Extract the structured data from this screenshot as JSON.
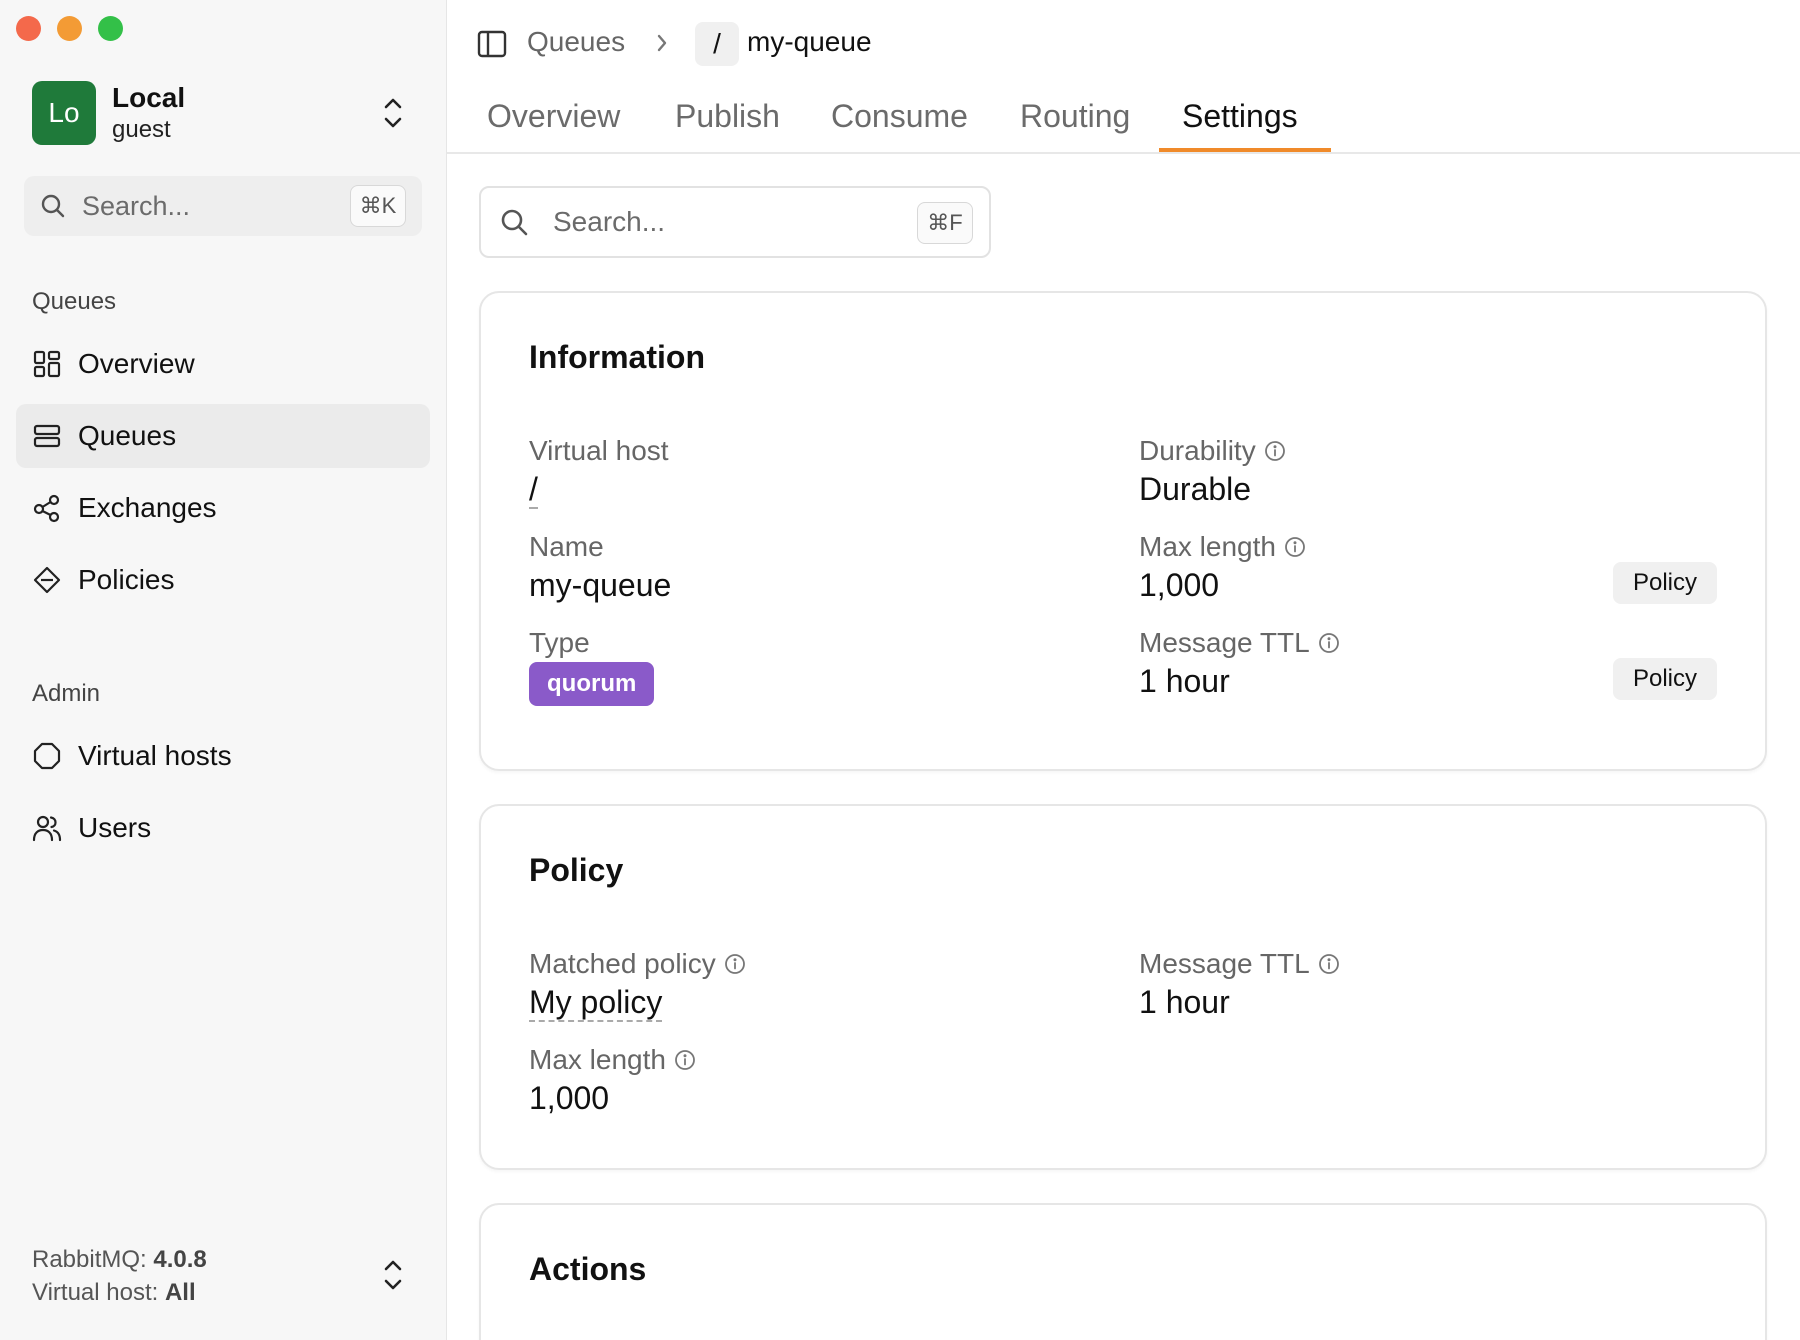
{
  "sidebar": {
    "account": {
      "initials": "Lo",
      "name": "Local",
      "user": "guest"
    },
    "search": {
      "placeholder": "Search...",
      "shortcut": "⌘K"
    },
    "sections": {
      "queues": {
        "label": "Queues",
        "items": [
          {
            "label": "Overview",
            "icon": "grid-icon"
          },
          {
            "label": "Queues",
            "icon": "stack-icon"
          },
          {
            "label": "Exchanges",
            "icon": "exchange-icon"
          },
          {
            "label": "Policies",
            "icon": "diamond-icon"
          }
        ]
      },
      "admin": {
        "label": "Admin",
        "items": [
          {
            "label": "Virtual hosts",
            "icon": "hexagon-icon"
          },
          {
            "label": "Users",
            "icon": "users-icon"
          }
        ]
      }
    },
    "footer": {
      "rabbitmq_label": "RabbitMQ:",
      "rabbitmq_version": "4.0.8",
      "vhost_label": "Virtual host:",
      "vhost_value": "All"
    }
  },
  "breadcrumb": {
    "parent": "Queues",
    "vhost": "/",
    "queue": "my-queue"
  },
  "tabs": [
    "Overview",
    "Publish",
    "Consume",
    "Routing",
    "Settings"
  ],
  "active_tab": "Settings",
  "search": {
    "placeholder": "Search...",
    "shortcut": "⌘F"
  },
  "information": {
    "title": "Information",
    "virtual_host": {
      "label": "Virtual host",
      "value": "/"
    },
    "name": {
      "label": "Name",
      "value": "my-queue"
    },
    "type": {
      "label": "Type",
      "value": "quorum"
    },
    "durability": {
      "label": "Durability",
      "value": "Durable"
    },
    "max_length": {
      "label": "Max length",
      "value": "1,000",
      "button": "Policy"
    },
    "message_ttl": {
      "label": "Message TTL",
      "value": "1 hour",
      "button": "Policy"
    }
  },
  "policy": {
    "title": "Policy",
    "matched_policy": {
      "label": "Matched policy",
      "value": "My policy"
    },
    "max_length": {
      "label": "Max length",
      "value": "1,000"
    },
    "message_ttl": {
      "label": "Message TTL",
      "value": "1 hour"
    }
  },
  "actions": {
    "title": "Actions"
  },
  "colors": {
    "accent": "#f08a2a",
    "avatar": "#1f7a3a",
    "quorum_badge": "#8a5ac9"
  }
}
